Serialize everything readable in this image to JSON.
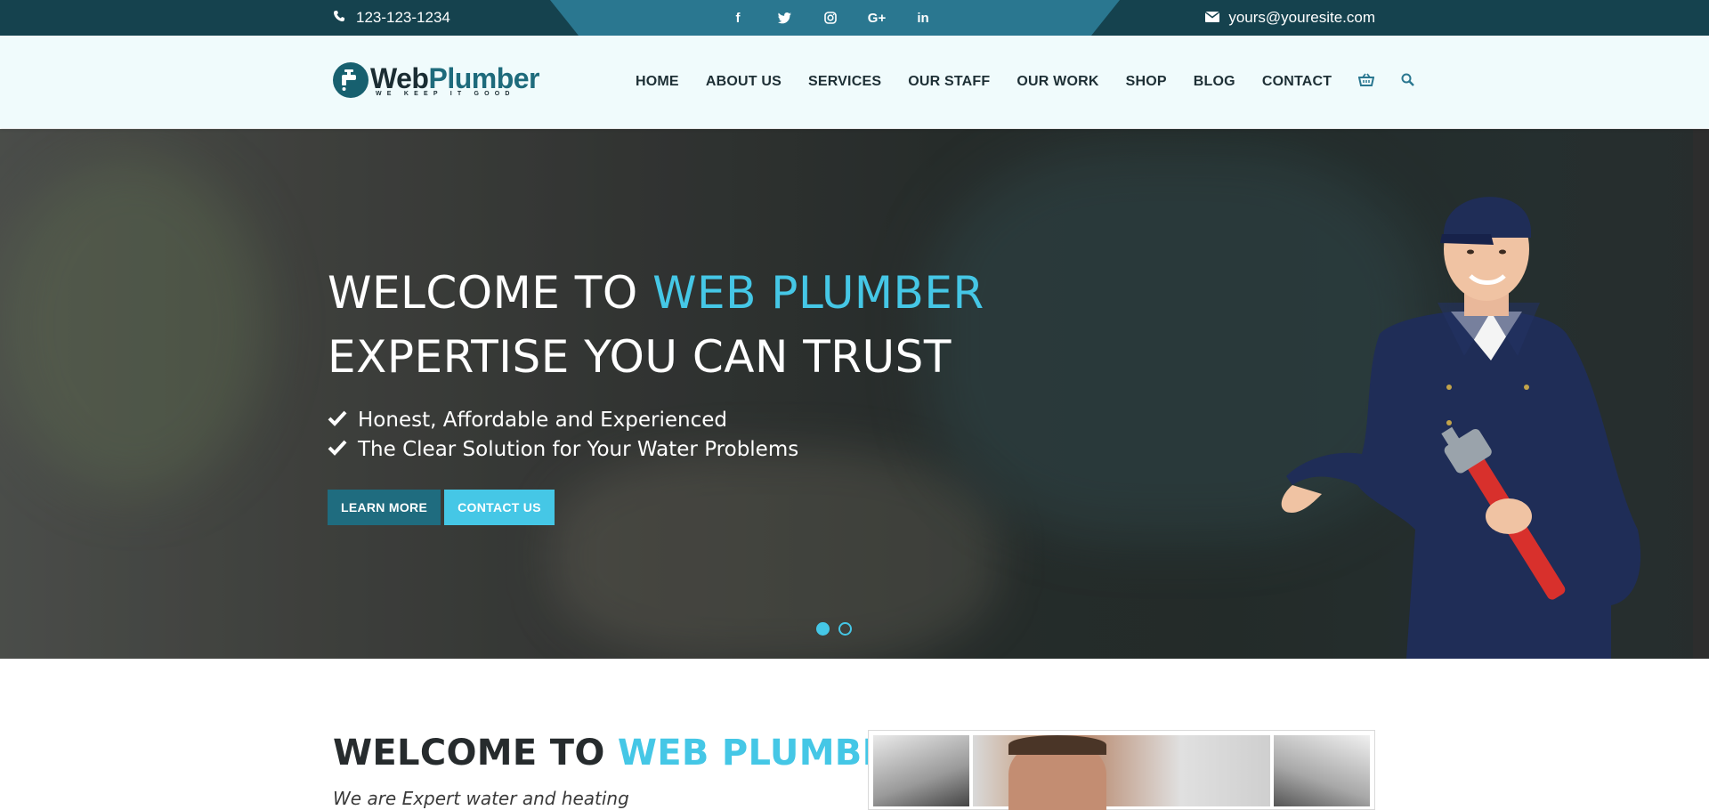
{
  "topbar": {
    "phone": "123-123-1234",
    "email": "yours@youresite.com",
    "socials": [
      "facebook-icon",
      "twitter-icon",
      "instagram-icon",
      "google-plus-icon",
      "linkedin-icon"
    ]
  },
  "header": {
    "logo": {
      "name_part1": "Web",
      "name_part2": "Plumber",
      "tagline": "WE KEEP IT GOOD"
    },
    "nav": [
      "HOME",
      "ABOUT US",
      "SERVICES",
      "OUR STAFF",
      "OUR WORK",
      "SHOP",
      "BLOG",
      "CONTACT"
    ],
    "nav_icons": [
      "basket-icon",
      "search-icon"
    ]
  },
  "hero": {
    "title_prefix": "WELCOME TO ",
    "title_accent": "WEB PLUMBER",
    "title_line2": "EXPERTISE YOU CAN TRUST",
    "checks": [
      "Honest, Affordable and Experienced",
      "The Clear Solution for Your Water Problems"
    ],
    "learn_more_label": "LEARN MORE",
    "contact_label": "CONTACT US",
    "slides_total": 2,
    "active_slide": 1
  },
  "about": {
    "title_prefix": "WELCOME TO ",
    "title_accent": "WEB PLUMBER",
    "subtitle": "We are Expert water and heating"
  },
  "colors": {
    "topbar": "#15424e",
    "topbar_tab": "#2a7790",
    "accent": "#45c7e6",
    "button_dark": "#1f6c7f",
    "header_bg": "#f0fbfc"
  }
}
